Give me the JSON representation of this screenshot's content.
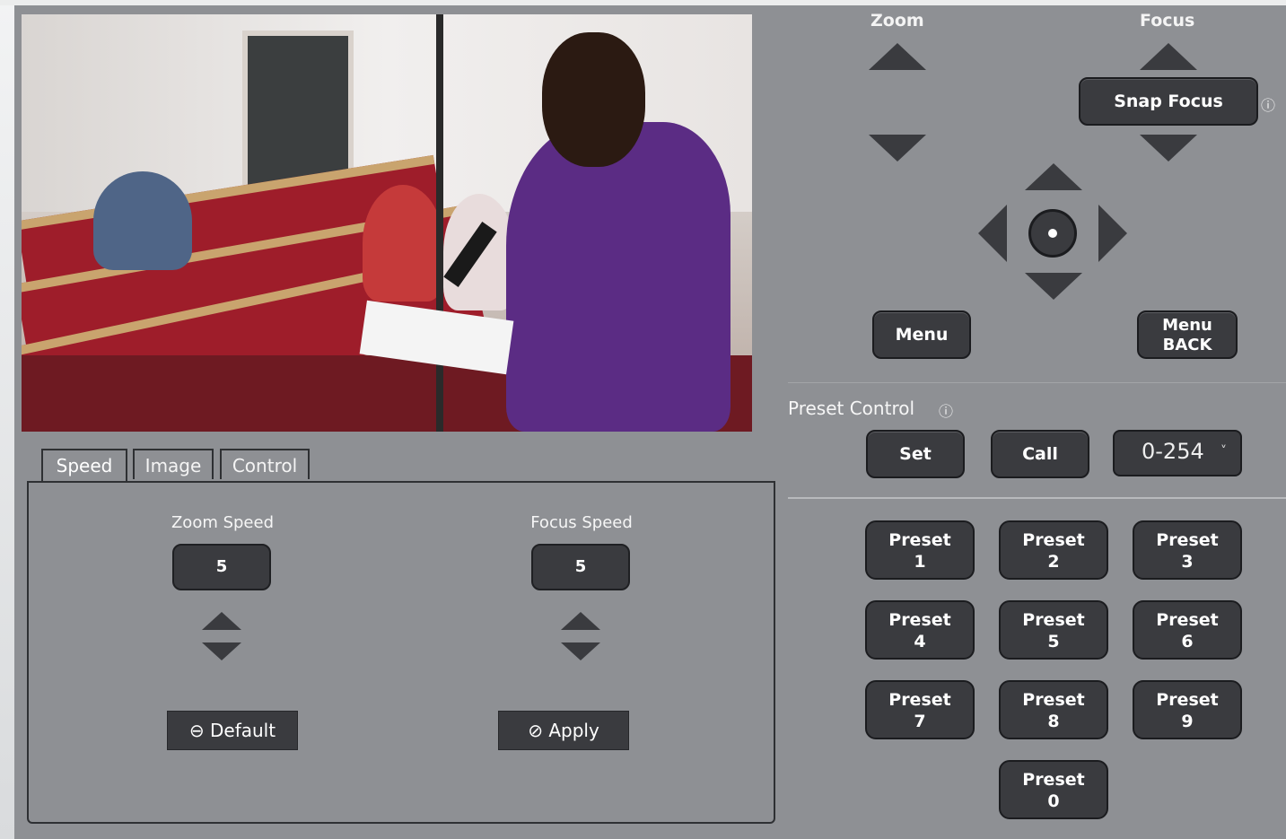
{
  "preview": {
    "description_icon": "camera-preview-image"
  },
  "tabs": [
    {
      "label": "Speed",
      "active": true
    },
    {
      "label": "Image",
      "active": false
    },
    {
      "label": "Control",
      "active": false
    }
  ],
  "speed": {
    "zoom_label": "Zoom Speed",
    "zoom_value": "5",
    "focus_label": "Focus Speed",
    "focus_value": "5",
    "default_label": "⊖ Default",
    "apply_label": "⊘ Apply"
  },
  "ptz": {
    "zoom_title": "Zoom",
    "focus_title": "Focus",
    "snap_focus_label": "Snap Focus",
    "info_glyph": "ⓘ",
    "menu_label": "Menu",
    "menu_back_line1": "Menu",
    "menu_back_line2": "BACK"
  },
  "preset_control": {
    "title": "Preset Control",
    "info_glyph": "ⓘ",
    "set_label": "Set",
    "call_label": "Call",
    "select_value": "0-254",
    "select_chevron": "˅"
  },
  "presets": [
    {
      "line1": "Preset",
      "line2": "1"
    },
    {
      "line1": "Preset",
      "line2": "2"
    },
    {
      "line1": "Preset",
      "line2": "3"
    },
    {
      "line1": "Preset",
      "line2": "4"
    },
    {
      "line1": "Preset",
      "line2": "5"
    },
    {
      "line1": "Preset",
      "line2": "6"
    },
    {
      "line1": "Preset",
      "line2": "7"
    },
    {
      "line1": "Preset",
      "line2": "8"
    },
    {
      "line1": "Preset",
      "line2": "9"
    },
    {
      "line1": "Preset",
      "line2": "0"
    }
  ],
  "colors": {
    "panel": "#8e9094",
    "button": "#3a3b3f",
    "border": "#1b1c1f",
    "text": "#ffffff"
  }
}
